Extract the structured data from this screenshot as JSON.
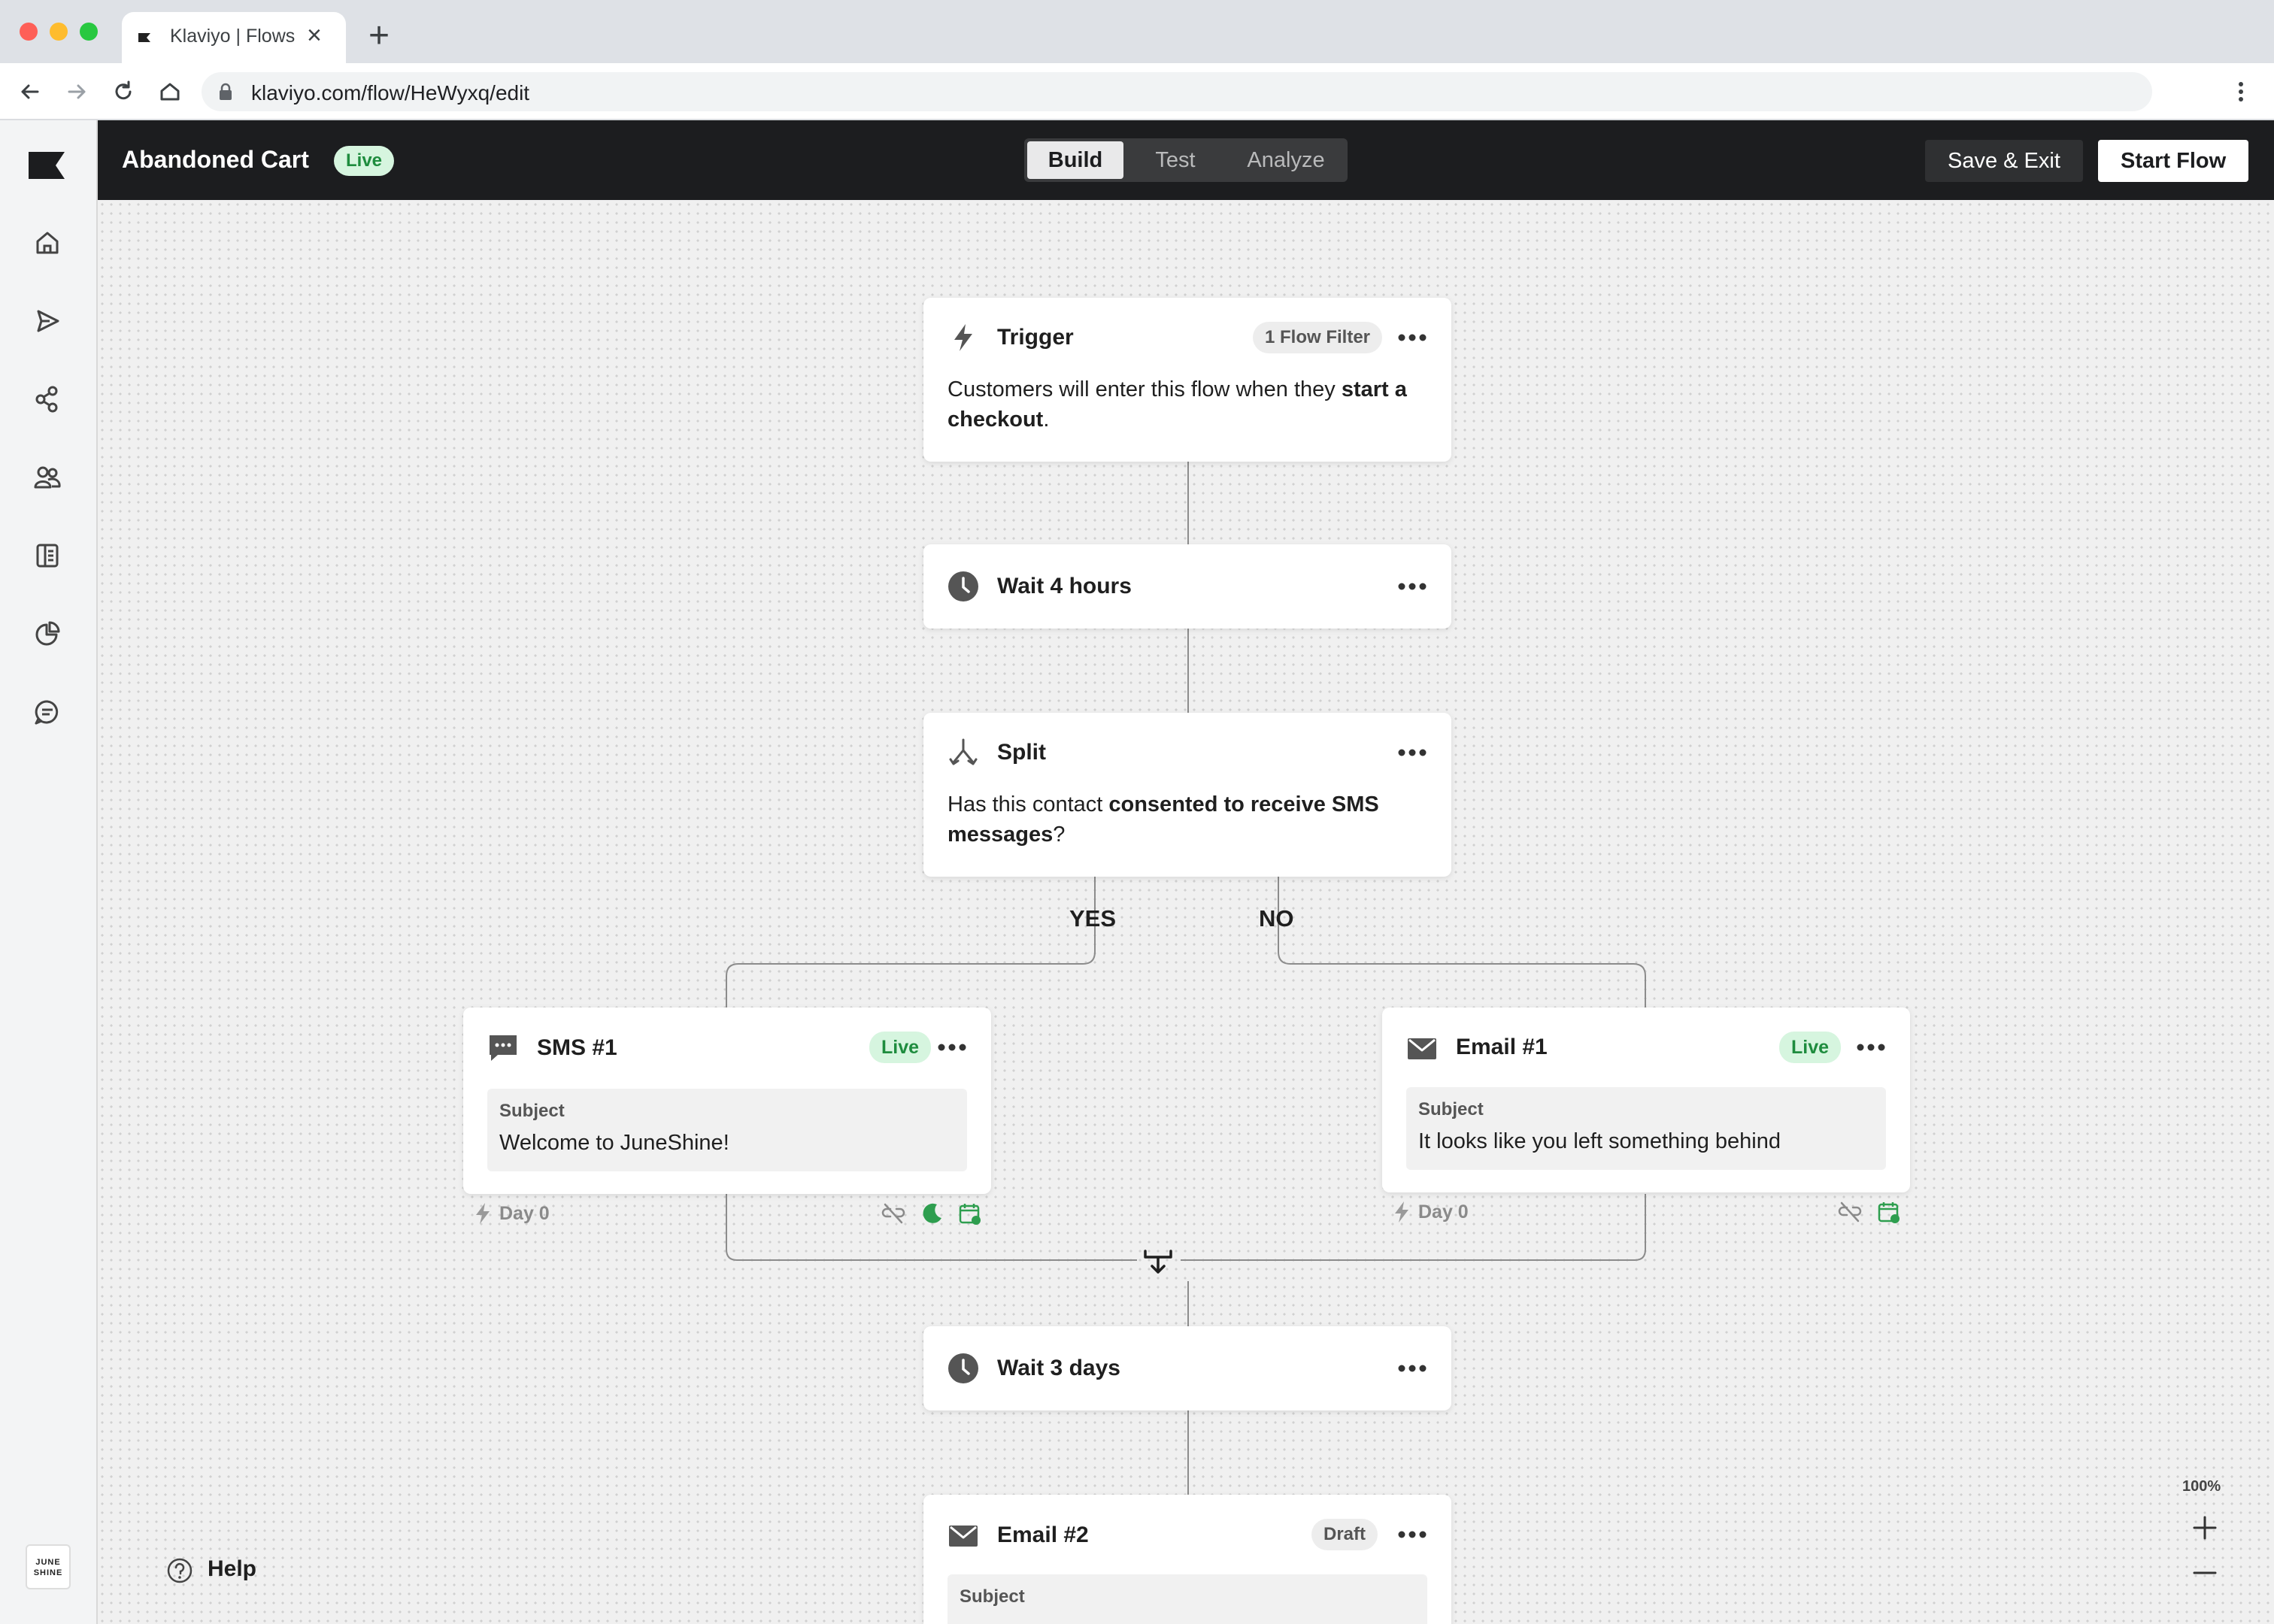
{
  "browser": {
    "tab_title": "Klaviyo | Flows",
    "url": "klaviyo.com/flow/HeWyxq/edit"
  },
  "header": {
    "flow_name": "Abandoned Cart",
    "status": "Live",
    "tabs": [
      {
        "label": "Build",
        "active": true
      },
      {
        "label": "Test",
        "active": false
      },
      {
        "label": "Analyze",
        "active": false
      }
    ],
    "save_exit_label": "Save & Exit",
    "start_flow_label": "Start Flow"
  },
  "rail": {
    "icons": [
      "home-icon",
      "campaigns-icon",
      "flows-icon",
      "audience-icon",
      "content-icon",
      "analytics-icon",
      "conversations-icon"
    ],
    "brand_logo_text": "JUNE SHINE"
  },
  "flow": {
    "trigger": {
      "title": "Trigger",
      "filter_badge": "1 Flow Filter",
      "text_before": "Customers will enter this flow when they ",
      "text_bold": "start a checkout",
      "text_after": "."
    },
    "wait_1": {
      "label": "Wait 4 hours"
    },
    "split": {
      "title": "Split",
      "text_before": "Has this contact ",
      "text_bold": "consented to receive SMS messages",
      "text_after": "?",
      "yes_label": "YES",
      "no_label": "NO"
    },
    "sms_1": {
      "title": "SMS #1",
      "status": "Live",
      "subject_label": "Subject",
      "subject": "Welcome to JuneShine!",
      "day": "Day 0"
    },
    "email_1": {
      "title": "Email #1",
      "status": "Live",
      "subject_label": "Subject",
      "subject": "It looks like you left something behind",
      "day": "Day 0"
    },
    "wait_2": {
      "label": "Wait 3 days"
    },
    "email_2": {
      "title": "Email #2",
      "status": "Draft",
      "subject_label": "Subject"
    }
  },
  "footer": {
    "help_label": "Help",
    "zoom": "100%"
  },
  "colors": {
    "header_bg": "#1c1d1f",
    "live_green": "#1e8c3e",
    "live_bg": "#d6f5df",
    "calendar_green": "#2e9e4f"
  }
}
